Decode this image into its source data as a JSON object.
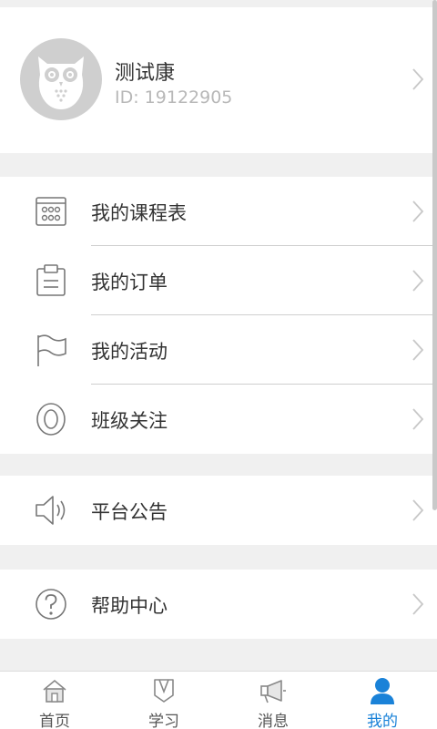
{
  "profile": {
    "name": "测试康",
    "id_text": "ID: 19122905"
  },
  "menu_groups": [
    {
      "items": [
        {
          "label": "我的课程表",
          "icon": "calendar-grid-icon"
        },
        {
          "label": "我的订单",
          "icon": "clipboard-icon"
        },
        {
          "label": "我的活动",
          "icon": "flag-icon"
        },
        {
          "label": "班级关注",
          "icon": "eye-icon"
        }
      ]
    },
    {
      "items": [
        {
          "label": "平台公告",
          "icon": "speaker-icon"
        }
      ]
    },
    {
      "items": [
        {
          "label": "帮助中心",
          "icon": "question-icon"
        }
      ]
    }
  ],
  "tabbar": {
    "tabs": [
      {
        "label": "首页",
        "icon": "home-icon",
        "active": false
      },
      {
        "label": "学习",
        "icon": "book-icon",
        "active": false
      },
      {
        "label": "消息",
        "icon": "megaphone-icon",
        "active": false
      },
      {
        "label": "我的",
        "icon": "person-icon",
        "active": true
      }
    ]
  },
  "colors": {
    "accent": "#1a82d8",
    "background": "#f0f0f0",
    "text": "#333333",
    "muted": "#b8b8b8"
  }
}
